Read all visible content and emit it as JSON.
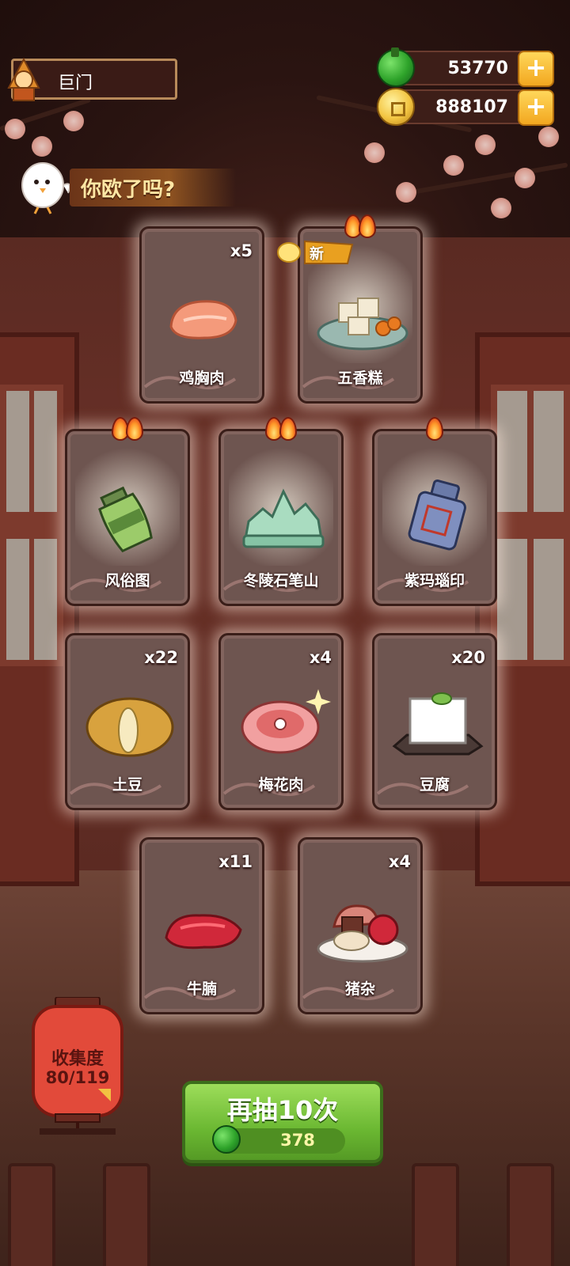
{
  "header": {
    "location": "巨门",
    "currencies": [
      {
        "icon": "jade-gem-icon",
        "value": "53770"
      },
      {
        "icon": "copper-coin-icon",
        "value": "888107"
      }
    ]
  },
  "banner": {
    "text": "你欧了吗?"
  },
  "cards": [
    {
      "name": "鸡胸肉",
      "count": "x5",
      "flames": 0,
      "is_new": false,
      "icon": "chicken-breast-icon"
    },
    {
      "name": "五香糕",
      "count": "",
      "flames": 2,
      "is_new": true,
      "new_label": "新",
      "icon": "five-spice-cake-icon"
    },
    {
      "name": "风俗图",
      "count": "",
      "flames": 2,
      "is_new": false,
      "icon": "custom-painting-jar-icon"
    },
    {
      "name": "冬陵石笔山",
      "count": "",
      "flames": 2,
      "is_new": false,
      "icon": "jade-brush-rest-icon"
    },
    {
      "name": "紫玛瑙印",
      "count": "",
      "flames": 1,
      "is_new": false,
      "icon": "agate-seal-icon"
    },
    {
      "name": "土豆",
      "count": "x22",
      "flames": 0,
      "is_new": false,
      "icon": "potato-icon"
    },
    {
      "name": "梅花肉",
      "count": "x4",
      "flames": 0,
      "is_new": false,
      "icon": "pork-shoulder-icon"
    },
    {
      "name": "豆腐",
      "count": "x20",
      "flames": 0,
      "is_new": false,
      "icon": "tofu-icon"
    },
    {
      "name": "牛腩",
      "count": "x11",
      "flames": 0,
      "is_new": false,
      "icon": "beef-brisket-icon"
    },
    {
      "name": "猪杂",
      "count": "x4",
      "flames": 0,
      "is_new": false,
      "icon": "pork-offal-icon"
    }
  ],
  "collection": {
    "label": "收集度",
    "progress": "80/119"
  },
  "draw_button": {
    "label": "再抽10次",
    "cost": "378"
  },
  "colors": {
    "accent_green": "#6bb832",
    "plus_orange": "#f2a720",
    "lantern_red": "#e24a3a"
  }
}
